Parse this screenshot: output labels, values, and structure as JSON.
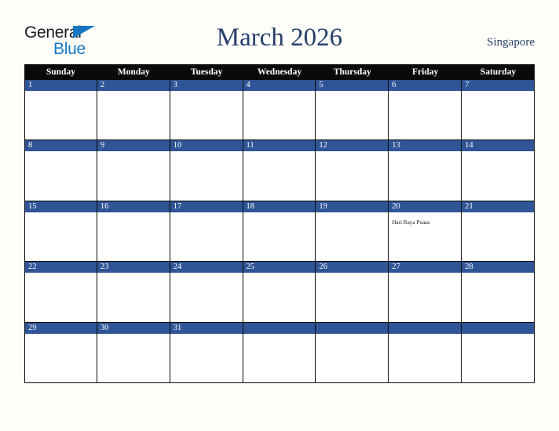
{
  "brand": {
    "name_part1": "General",
    "name_part2": "Blue",
    "triangle_icon": "triangle-right-icon",
    "accent_color": "#1577c4"
  },
  "header": {
    "title": "March 2026",
    "region": "Singapore",
    "title_color": "#26406b"
  },
  "calendar": {
    "weekday_headers": [
      "Sunday",
      "Monday",
      "Tuesday",
      "Wednesday",
      "Thursday",
      "Friday",
      "Saturday"
    ],
    "header_bg": "#0a0a0a",
    "day_band_bg": "#2f5596",
    "weeks": [
      [
        {
          "day": "1",
          "event": ""
        },
        {
          "day": "2",
          "event": ""
        },
        {
          "day": "3",
          "event": ""
        },
        {
          "day": "4",
          "event": ""
        },
        {
          "day": "5",
          "event": ""
        },
        {
          "day": "6",
          "event": ""
        },
        {
          "day": "7",
          "event": ""
        }
      ],
      [
        {
          "day": "8",
          "event": ""
        },
        {
          "day": "9",
          "event": ""
        },
        {
          "day": "10",
          "event": ""
        },
        {
          "day": "11",
          "event": ""
        },
        {
          "day": "12",
          "event": ""
        },
        {
          "day": "13",
          "event": ""
        },
        {
          "day": "14",
          "event": ""
        }
      ],
      [
        {
          "day": "15",
          "event": ""
        },
        {
          "day": "16",
          "event": ""
        },
        {
          "day": "17",
          "event": ""
        },
        {
          "day": "18",
          "event": ""
        },
        {
          "day": "19",
          "event": ""
        },
        {
          "day": "20",
          "event": "Hari Raya Puasa"
        },
        {
          "day": "21",
          "event": ""
        }
      ],
      [
        {
          "day": "22",
          "event": ""
        },
        {
          "day": "23",
          "event": ""
        },
        {
          "day": "24",
          "event": ""
        },
        {
          "day": "25",
          "event": ""
        },
        {
          "day": "26",
          "event": ""
        },
        {
          "day": "27",
          "event": ""
        },
        {
          "day": "28",
          "event": ""
        }
      ],
      [
        {
          "day": "29",
          "event": ""
        },
        {
          "day": "30",
          "event": ""
        },
        {
          "day": "31",
          "event": ""
        },
        {
          "day": "",
          "event": ""
        },
        {
          "day": "",
          "event": ""
        },
        {
          "day": "",
          "event": ""
        },
        {
          "day": "",
          "event": ""
        }
      ]
    ]
  }
}
